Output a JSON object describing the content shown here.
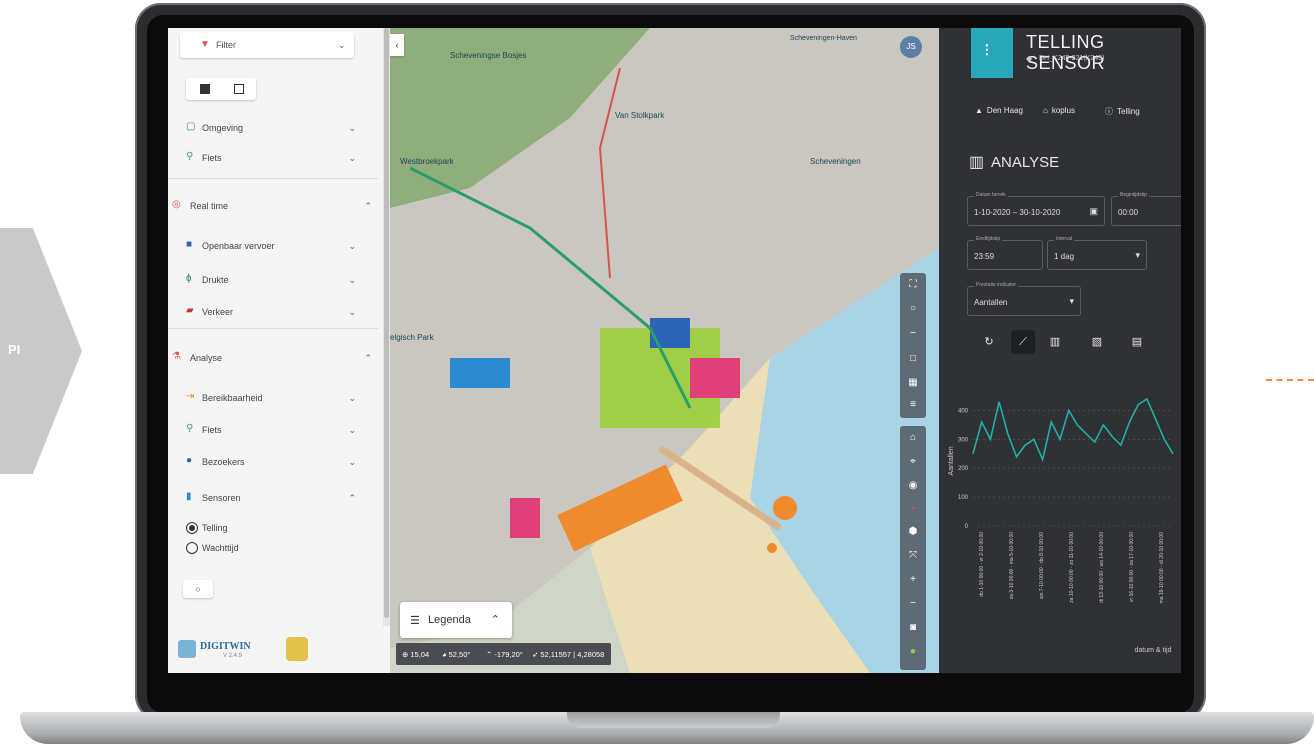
{
  "page": {
    "side_label": "PI"
  },
  "left_panel": {
    "filter_label": "Filter",
    "sections": {
      "omgeving": "Omgeving",
      "fiets": "Fiets",
      "realtime": "Real time",
      "ov": "Openbaar vervoer",
      "drukte": "Drukte",
      "verkeer": "Verkeer",
      "analyse": "Analyse",
      "bereik": "Bereikbaarheid",
      "fiets2": "Fiets",
      "bezoekers": "Bezoekers",
      "sensoren": "Sensoren"
    },
    "radio": {
      "telling": "Telling",
      "wachttijd": "Wachttijd"
    },
    "logo": {
      "name": "DIGITWIN",
      "version": "V 2.4.9"
    }
  },
  "map": {
    "labels": {
      "bosjes": "Scheveningse Bosjes",
      "vanstolk": "Van Stolkpark",
      "westbroek": "Westbroekpark",
      "schev": "Scheveningen",
      "belgisch": "elgisch Park",
      "haven": "Scheveningen-Haven"
    },
    "avatar": "JS",
    "legend_label": "Legenda",
    "coords": {
      "zoom": "15,04",
      "pitch": "52,50°",
      "bearing": "-179,20°",
      "latlon": "52,11557 | 4,28058"
    }
  },
  "right_panel": {
    "title": "TELLING SENSOR",
    "sensor_id": "DH_K245-221(K245)",
    "chips": [
      "Den Haag",
      "koplus",
      "Telling"
    ],
    "section_title": "ANALYSE",
    "fields": {
      "datum_label": "Datum bereik",
      "datum_value": "1-10-2020 – 30-10-2020",
      "begin_label": "Begintijdstip",
      "begin_value": "00:00",
      "eind_label": "Eindtijdstip",
      "eind_value": "23:59",
      "interval_label": "Interval",
      "interval_value": "1 dag",
      "prestatie_label": "Prestatie indicator",
      "prestatie_value": "Aantallen"
    }
  },
  "chart_data": {
    "type": "line",
    "ylabel": "Aantallen",
    "xlabel": "datum & tijd",
    "ylim": [
      0,
      450
    ],
    "yticks": [
      0,
      100,
      200,
      300,
      400
    ],
    "x": [
      "do 1-10 00:00 - vr 2-10 00:00",
      "za 3-10 00:00 - ma 5-10 00:00",
      "wo 7-10 00:00 - do 8-10 00:00",
      "za 10-10 00:00 - zo 11-10 00:00",
      "di 13-10 00:00 - wo 14-10 00:00",
      "vr 16-10 00:00 - za 17-10 00:00",
      "ma 19-10 00:00 - di 20-10 00:00"
    ],
    "values": [
      250,
      360,
      300,
      430,
      320,
      240,
      280,
      300,
      230,
      360,
      300,
      400,
      350,
      320,
      290,
      350,
      310,
      280,
      360,
      420,
      440,
      370,
      300,
      250
    ],
    "color": "#1fb0a6"
  }
}
